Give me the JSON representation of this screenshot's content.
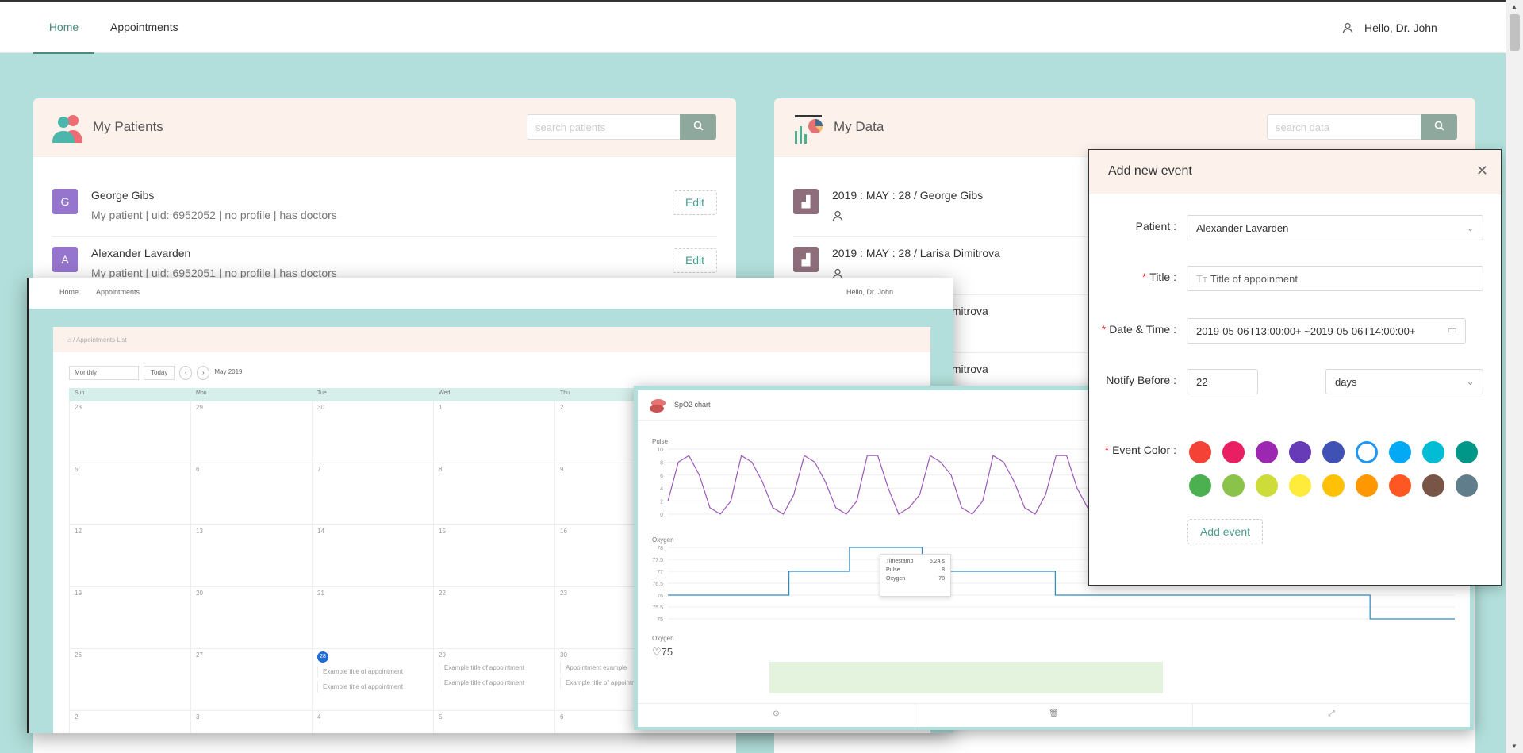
{
  "nav": {
    "home": "Home",
    "appointments": "Appointments",
    "greeting": "Hello, Dr. John"
  },
  "patients": {
    "title": "My Patients",
    "search_placeholder": "search patients",
    "edit_label": "Edit",
    "rows": [
      {
        "initial": "G",
        "name": "George Gibs",
        "sub": "My patient | uid: 6952052 | no profile | has doctors"
      },
      {
        "initial": "A",
        "name": "Alexander Lavarden",
        "sub": "My patient | uid: 6952051 | no profile | has doctors"
      }
    ]
  },
  "mydata": {
    "title": "My Data",
    "search_placeholder": "search data",
    "rows": [
      {
        "label": "2019 : MAY : 28 / George Gibs"
      },
      {
        "label": "2019 : MAY : 28 / Larisa Dimitrova"
      },
      {
        "label": "a Dimitrova"
      },
      {
        "label": "a Dimitrova"
      }
    ]
  },
  "calendar_shot": {
    "nav_home": "Home",
    "nav_appointments": "Appointments",
    "greeting": "Hello, Dr. John",
    "breadcrumb": "/ Appointments List",
    "view": "Monthly",
    "today": "Today",
    "month": "May 2019",
    "dow": [
      "Sun",
      "Mon",
      "Tue",
      "Wed",
      "Thu"
    ],
    "weeks": [
      [
        "28",
        "29",
        "30",
        "1",
        "2"
      ],
      [
        "5",
        "6",
        "7",
        "8",
        "9"
      ],
      [
        "12",
        "13",
        "14",
        "15",
        "16"
      ],
      [
        "19",
        "20",
        "21",
        "22",
        "23"
      ],
      [
        "26",
        "27",
        "28",
        "29",
        "30"
      ],
      [
        "2",
        "3",
        "4",
        "5",
        "6"
      ]
    ],
    "events": {
      "tue": [
        "Example title of appointment",
        "Example title of appointment"
      ],
      "wed": [
        "Example title of appointment",
        "Example title of appointment"
      ],
      "thu": [
        "Appointment example",
        "Example title of appointment"
      ]
    }
  },
  "chart_shot": {
    "title": "SpO2 chart",
    "pulse_label": "Pulse",
    "pulse_ticks": [
      "10",
      "8",
      "6",
      "4",
      "2",
      "0"
    ],
    "oxygen_label": "Oxygen",
    "oxygen_ticks": [
      "78",
      "77.5",
      "77",
      "76.5",
      "76",
      "75.5",
      "75"
    ],
    "oxygen_label2": "Oxygen",
    "current_value": "75",
    "tooltip": [
      {
        "k": "Timestamp",
        "v": "5.24 s"
      },
      {
        "k": "Pulse",
        "v": "8"
      },
      {
        "k": "Oxygen",
        "v": "78"
      }
    ]
  },
  "chart_data": [
    {
      "type": "line",
      "title": "Pulse",
      "ylim": [
        0,
        10
      ],
      "series": [
        {
          "values": [
            2,
            8,
            9,
            6,
            1,
            0,
            2,
            9,
            8,
            5,
            1,
            0,
            3,
            9,
            8,
            5,
            1,
            0,
            2,
            9,
            9,
            4,
            0,
            1,
            3,
            9,
            8,
            6,
            1,
            0,
            2,
            9,
            8,
            5,
            1,
            0,
            3,
            9,
            9,
            4,
            1,
            0,
            2,
            8,
            9,
            5,
            1,
            0,
            3,
            9,
            8,
            4,
            0,
            1,
            2,
            9,
            8,
            6,
            1,
            0,
            3,
            8,
            9,
            5,
            1,
            0,
            2,
            9,
            8,
            4,
            1,
            0,
            3,
            9,
            8,
            6
          ]
        }
      ]
    },
    {
      "type": "line",
      "title": "Oxygen",
      "ylim": [
        75,
        78
      ],
      "series": [
        {
          "values": [
            76,
            76,
            76,
            76,
            76,
            76,
            76,
            76,
            76,
            76,
            77,
            77,
            77,
            77,
            77,
            78,
            78,
            78,
            78,
            78,
            78,
            77,
            77,
            77,
            77,
            77,
            77,
            77,
            77,
            77,
            77,
            77,
            76,
            76,
            76,
            76,
            76,
            76,
            76,
            76,
            76,
            76,
            76,
            76,
            76,
            76,
            76,
            76,
            76,
            76,
            76,
            76,
            76,
            76,
            76,
            76,
            76,
            76,
            75,
            75,
            75,
            75,
            75,
            75,
            75,
            75
          ]
        }
      ]
    }
  ],
  "modal": {
    "title": "Add new event",
    "patient_label": "Patient",
    "patient_value": "Alexander Lavarden",
    "title_label": "Title",
    "title_placeholder": "Title of appoinment",
    "datetime_label": "Date & Time",
    "datetime_value": "2019-05-06T13:00:00+ ~2019-05-06T14:00:00+",
    "notify_label": "Notify Before",
    "notify_value": "22",
    "notify_unit": "days",
    "color_label": "Event Color",
    "colors": [
      "#f44336",
      "#e91e63",
      "#9c27b0",
      "#673ab7",
      "#3f51b5",
      "#ffffff",
      "#03a9f4",
      "#00bcd4",
      "#009688",
      "#4caf50",
      "#8bc34a",
      "#cddc39",
      "#ffeb3b",
      "#ffc107",
      "#ff9800",
      "#ff5722",
      "#795548",
      "#607d8b"
    ],
    "selected_color": "#2196f3",
    "add_label": "Add event"
  }
}
